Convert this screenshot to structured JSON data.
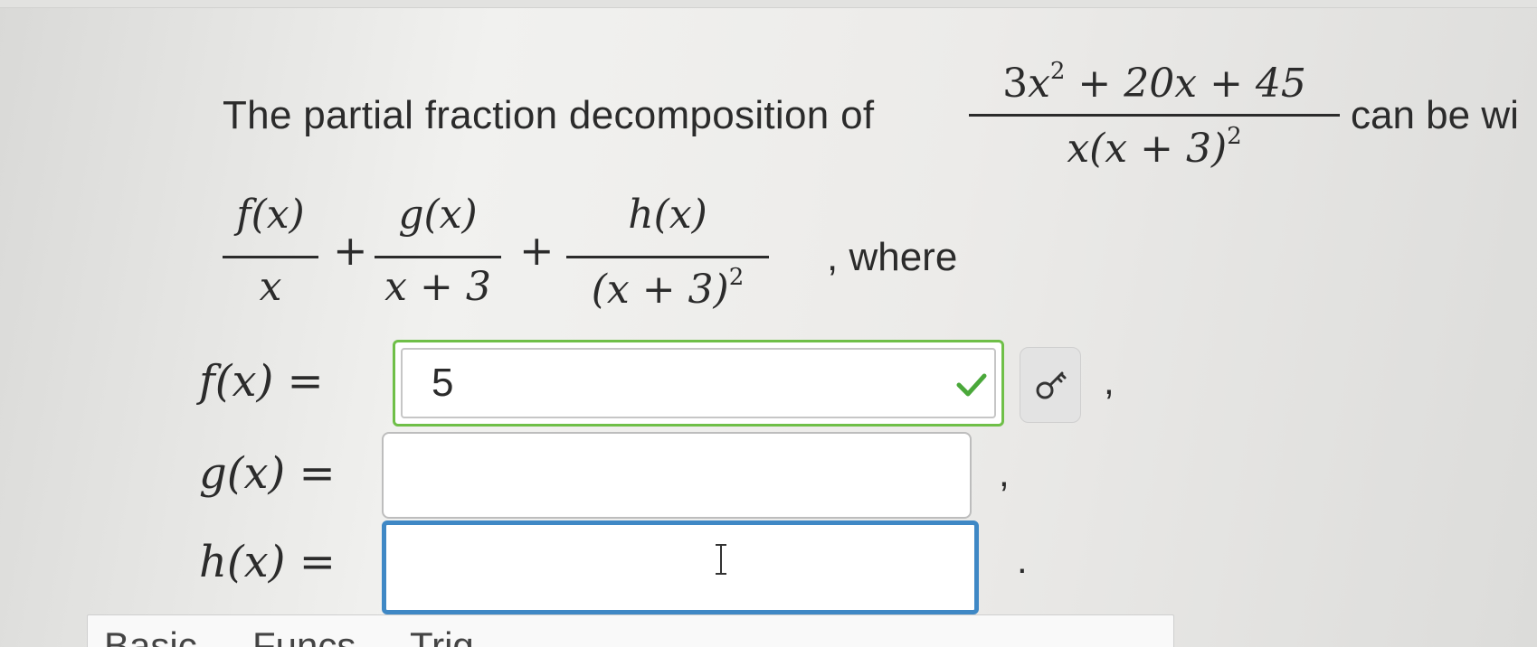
{
  "question": {
    "prefix": "The partial fraction decomposition of",
    "main_fraction": {
      "numerator_a": "3",
      "numerator_var": "x",
      "numerator_exp": "2",
      "numerator_rest": " + 20x + 45",
      "denominator": "x(x + 3)",
      "denominator_exp": "2"
    },
    "suffix": "can be wi"
  },
  "decomposition": {
    "term1_num": "f(x)",
    "term1_den": "x",
    "plus1": "+",
    "term2_num": "g(x)",
    "term2_den": "x + 3",
    "plus2": "+",
    "term3_num": "h(x)",
    "term3_den": "(x + 3)",
    "term3_den_exp": "2",
    "where": ", where"
  },
  "answers": {
    "f": {
      "label": "f(x) =",
      "value": "5",
      "status": "correct",
      "trailing": ","
    },
    "g": {
      "label": "g(x) =",
      "value": "",
      "trailing": ","
    },
    "h": {
      "label": "h(x) =",
      "value": "",
      "trailing": "."
    }
  },
  "tabs": [
    "Basic",
    "Funcs",
    "Trig"
  ],
  "icons": {
    "correct": "check-icon",
    "key": "key-icon",
    "cursor": "text-cursor-icon"
  },
  "colors": {
    "correct_border": "#6fbf48",
    "focus_border": "#3f88c5",
    "check": "#4aa83a"
  }
}
